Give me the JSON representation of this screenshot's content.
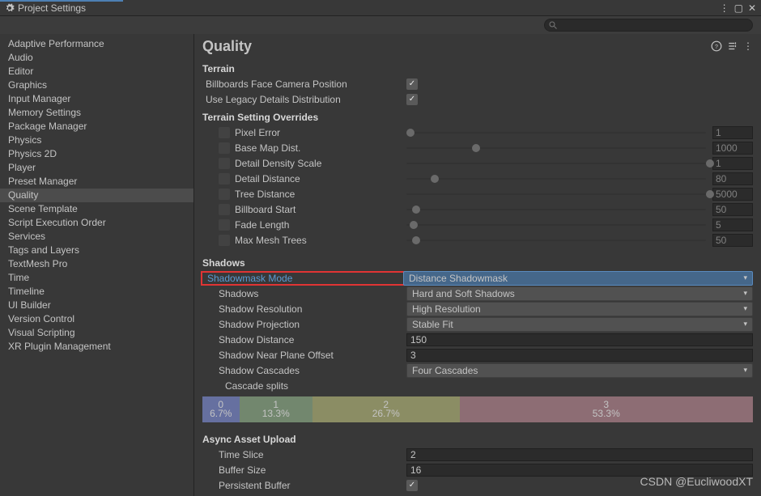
{
  "title": "Project Settings",
  "search": {
    "placeholder": ""
  },
  "sidebar": {
    "items": [
      "Adaptive Performance",
      "Audio",
      "Editor",
      "Graphics",
      "Input Manager",
      "Memory Settings",
      "Package Manager",
      "Physics",
      "Physics 2D",
      "Player",
      "Preset Manager",
      "Quality",
      "Scene Template",
      "Script Execution Order",
      "Services",
      "Tags and Layers",
      "TextMesh Pro",
      "Time",
      "Timeline",
      "UI Builder",
      "Version Control",
      "Visual Scripting",
      "XR Plugin Management"
    ],
    "selected": 11
  },
  "main": {
    "heading": "Quality",
    "terrain": {
      "heading": "Terrain",
      "billboards_label": "Billboards Face Camera Position",
      "billboards_checked": true,
      "legacy_label": "Use Legacy Details Distribution",
      "legacy_checked": true
    },
    "overrides": {
      "heading": "Terrain Setting Overrides",
      "rows": [
        {
          "label": "Pixel Error",
          "value": "1",
          "thumb": 0
        },
        {
          "label": "Base Map Dist.",
          "value": "1000",
          "thumb": 22
        },
        {
          "label": "Detail Density Scale",
          "value": "1",
          "thumb": 100
        },
        {
          "label": "Detail Distance",
          "value": "80",
          "thumb": 8
        },
        {
          "label": "Tree Distance",
          "value": "5000",
          "thumb": 100
        },
        {
          "label": "Billboard Start",
          "value": "50",
          "thumb": 2
        },
        {
          "label": "Fade Length",
          "value": "5",
          "thumb": 1
        },
        {
          "label": "Max Mesh Trees",
          "value": "50",
          "thumb": 2
        }
      ]
    },
    "shadows": {
      "heading": "Shadows",
      "mask_label": "Shadowmask Mode",
      "mask_value": "Distance Shadowmask",
      "shadows_label": "Shadows",
      "shadows_value": "Hard and Soft Shadows",
      "res_label": "Shadow Resolution",
      "res_value": "High Resolution",
      "proj_label": "Shadow Projection",
      "proj_value": "Stable Fit",
      "dist_label": "Shadow Distance",
      "dist_value": "150",
      "near_label": "Shadow Near Plane Offset",
      "near_value": "3",
      "casc_label": "Shadow Cascades",
      "casc_value": "Four Cascades",
      "splits_label": "Cascade splits",
      "cascade": [
        {
          "i": "0",
          "pct": "6.7%"
        },
        {
          "i": "1",
          "pct": "13.3%"
        },
        {
          "i": "2",
          "pct": "26.7%"
        },
        {
          "i": "3",
          "pct": "53.3%"
        }
      ]
    },
    "async": {
      "heading": "Async Asset Upload",
      "time_label": "Time Slice",
      "time_value": "2",
      "buf_label": "Buffer Size",
      "buf_value": "16",
      "persist_label": "Persistent Buffer",
      "persist_checked": true
    }
  },
  "watermark": "CSDN @EucliwoodXT"
}
